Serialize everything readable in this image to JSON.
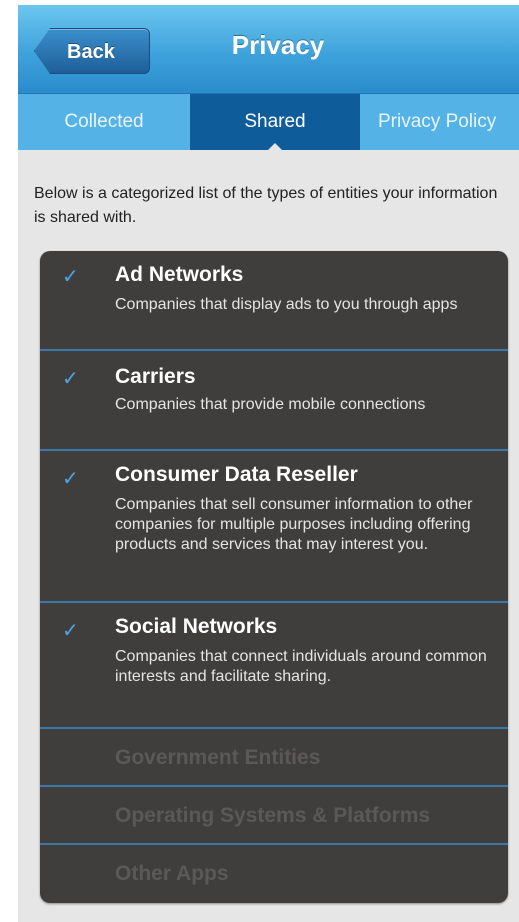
{
  "header": {
    "back_label": "Back",
    "title": "Privacy"
  },
  "tabs": [
    {
      "label": "Collected",
      "selected": false
    },
    {
      "label": "Shared",
      "selected": true
    },
    {
      "label": "Privacy Policy",
      "selected": false
    }
  ],
  "intro_text": "Below is a categorized list of the types of entities your information is shared with.",
  "entities": [
    {
      "name": "Ad Networks",
      "checked": true,
      "description": "Companies that display ads to you through apps"
    },
    {
      "name": "Carriers",
      "checked": true,
      "description": "Companies that provide mobile connections"
    },
    {
      "name": "Consumer Data Reseller",
      "checked": true,
      "description": "Companies that sell consumer information to other companies for multiple purposes including offering products and services that may interest you."
    },
    {
      "name": "Social Networks",
      "checked": true,
      "description": "Companies that connect individuals around common interests and facilitate sharing."
    },
    {
      "name": "Government Entities",
      "checked": false
    },
    {
      "name": "Operating Systems & Platforms",
      "checked": false
    },
    {
      "name": "Other Apps",
      "checked": false
    }
  ],
  "colors": {
    "header": "#3ea2db",
    "selected_tab": "#0f5c9a",
    "check": "#49a6e6",
    "list_bg": "#403e3d"
  }
}
